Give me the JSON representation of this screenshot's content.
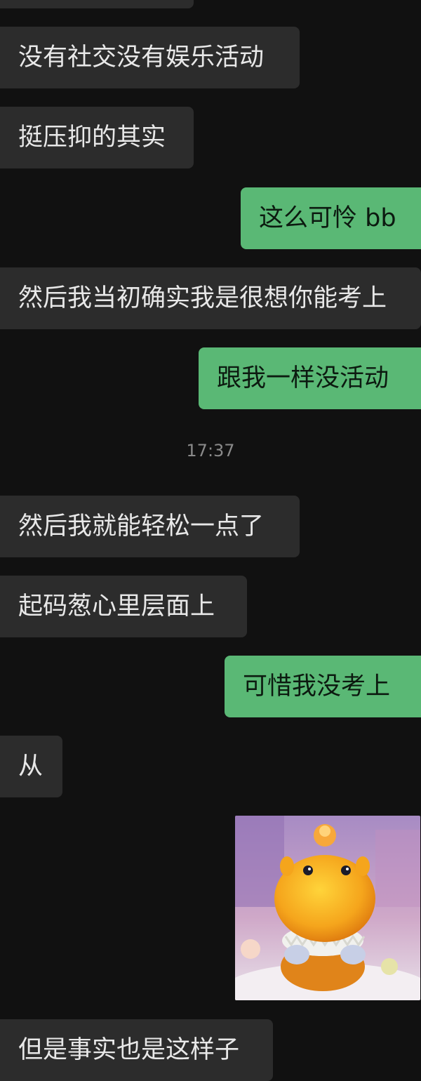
{
  "chat": {
    "timestamp": "17:37",
    "messages": [
      {
        "side": "in",
        "text": "没有社交没有娱乐活动"
      },
      {
        "side": "in",
        "text": "挺压抑的其实"
      },
      {
        "side": "out",
        "text": "这么可怜 bb"
      },
      {
        "side": "in",
        "text": "然后我当初确实我是很想你能考上"
      },
      {
        "side": "out",
        "text": "跟我一样没活动"
      },
      {
        "side": "in",
        "text": "然后我就能轻松一点了"
      },
      {
        "side": "in",
        "text": "起码葱心里层面上"
      },
      {
        "side": "out",
        "text": "可惜我没考上"
      },
      {
        "side": "in",
        "text": "从"
      },
      {
        "side": "out",
        "type": "sticker",
        "icon": "yellow-dinosaur-toy-sticker"
      },
      {
        "side": "in",
        "text": "但是事实也是这样子"
      }
    ]
  },
  "colors": {
    "background": "#111111",
    "incoming_bubble": "#2c2c2c",
    "outgoing_bubble": "#5ab875"
  }
}
